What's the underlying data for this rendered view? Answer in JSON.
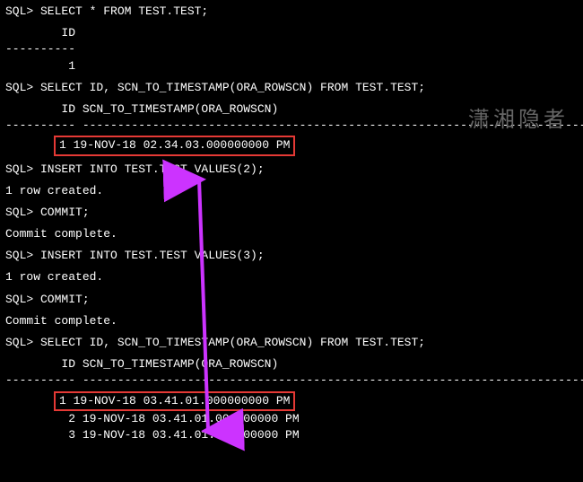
{
  "prompt": "SQL>",
  "q1": {
    "line": "SQL> SELECT * FROM TEST.TEST;",
    "header": "        ID",
    "divider": "----------",
    "row": "         1"
  },
  "q2": {
    "line": "SQL> SELECT ID, SCN_TO_TIMESTAMP(ORA_ROWSCN) FROM TEST.TEST;",
    "header": "        ID SCN_TO_TIMESTAMP(ORA_ROWSCN)",
    "divider": "---------- ---------------------------------------------------------------------------",
    "row1": "1 19-NOV-18 02.34.03.000000000 PM"
  },
  "ins1": {
    "line": "SQL> INSERT INTO TEST.TEST VALUES(2);",
    "msg": "1 row created."
  },
  "commit1": {
    "line": "SQL> COMMIT;",
    "msg": "Commit complete."
  },
  "ins2": {
    "line": "SQL> INSERT INTO TEST.TEST VALUES(3);",
    "msg": "1 row created."
  },
  "commit2": {
    "line": "SQL> COMMIT;",
    "msg": "Commit complete."
  },
  "q3": {
    "line": "SQL> SELECT ID, SCN_TO_TIMESTAMP(ORA_ROWSCN) FROM TEST.TEST;",
    "header": "        ID SCN_TO_TIMESTAMP(ORA_ROWSCN)",
    "divider": "---------- ---------------------------------------------------------------------------",
    "row1": "1 19-NOV-18 03.41.01.000000000 PM",
    "row2": "         2 19-NOV-18 03.41.01.000000000 PM",
    "row3": "         3 19-NOV-18 03.41.01.000000000 PM"
  },
  "watermark": "潇湘隐者",
  "colors": {
    "highlight": "#e53935",
    "arrow": "#cc33ff"
  }
}
